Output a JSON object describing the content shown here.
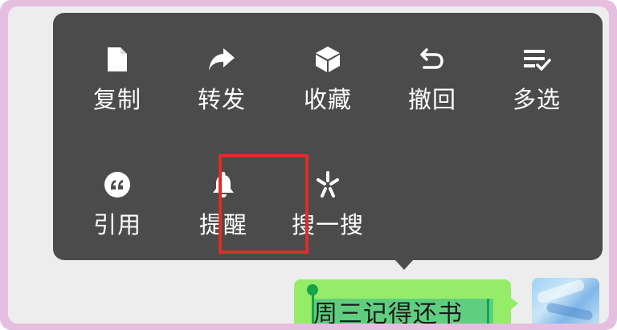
{
  "menu": {
    "row1": [
      {
        "label": "复制",
        "icon": "document-icon"
      },
      {
        "label": "转发",
        "icon": "forward-arrow-icon"
      },
      {
        "label": "收藏",
        "icon": "cube-icon"
      },
      {
        "label": "撤回",
        "icon": "undo-icon"
      },
      {
        "label": "多选",
        "icon": "list-check-icon"
      }
    ],
    "row2": [
      {
        "label": "引用",
        "icon": "quote-icon"
      },
      {
        "label": "提醒",
        "icon": "bell-icon"
      },
      {
        "label": "搜一搜",
        "icon": "sparkle-icon"
      }
    ],
    "highlighted_item": "提醒"
  },
  "chat": {
    "message_text": "周三记得还书",
    "bubble_color": "#95ec69"
  },
  "colors": {
    "menu_background": "#4b4b4b",
    "highlight_border": "#e02b2b",
    "selection": "#5fcf7f"
  }
}
